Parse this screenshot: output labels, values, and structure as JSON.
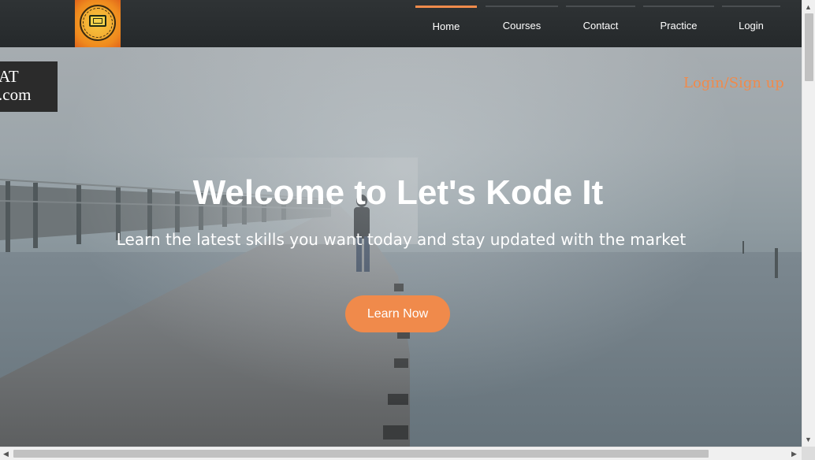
{
  "header": {
    "logo_icon": "lets-kode-it-logo",
    "nav": [
      {
        "label": "Home",
        "active": true
      },
      {
        "label": "Courses",
        "active": false
      },
      {
        "label": "Contact",
        "active": false
      },
      {
        "label": "Practice",
        "active": false
      },
      {
        "label": "Login",
        "active": false
      }
    ]
  },
  "badge": {
    "line1": "AT",
    "line2": ".com"
  },
  "hero": {
    "login_link": "Login/Sign up",
    "title": "Welcome to Let's Kode It",
    "subtitle": "Learn the latest skills you want today and stay updated with the market",
    "cta": "Learn Now"
  },
  "colors": {
    "accent": "#f08a4b",
    "header_bg": "#2b2f31",
    "badge_bg": "#2b2b2b"
  }
}
